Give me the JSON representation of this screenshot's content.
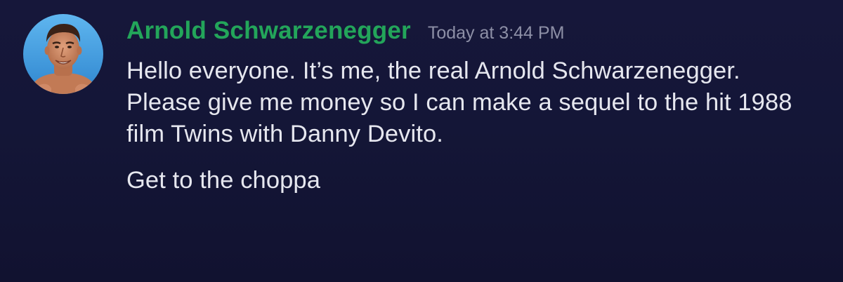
{
  "message": {
    "author": {
      "name": "Arnold Schwarzenegger",
      "name_color": "#23a55a",
      "avatar_icon": "user-avatar-photo"
    },
    "timestamp": "Today at 3:44 PM",
    "lines": [
      "Hello everyone. It’s me, the real Arnold Schwarzenegger.",
      "Please give me money so I can make a sequel to the hit 1988 film Twins with Danny Devito.",
      "Get to the choppa"
    ]
  },
  "colors": {
    "background": "#141637",
    "text": "#e6e7ef",
    "timestamp": "#8d8fa6",
    "avatar_background": "#4ea8e6"
  }
}
